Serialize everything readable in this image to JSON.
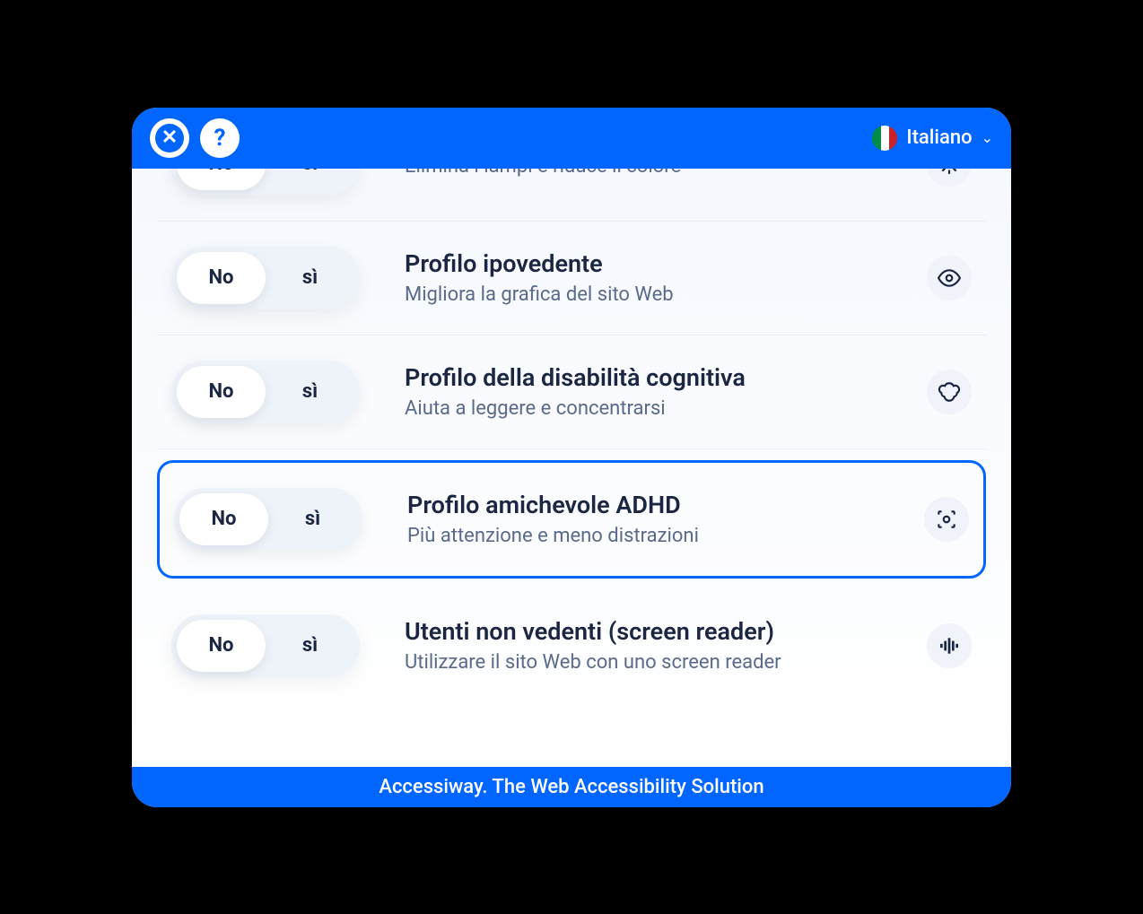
{
  "header": {
    "language_label": "Italiano",
    "flag_colors": [
      "#008c45",
      "#ffffff",
      "#cd212a"
    ]
  },
  "toggle": {
    "no": "No",
    "yes": "sì"
  },
  "profiles": [
    {
      "title": "",
      "desc": "Elimina i lampi e riduce il colore",
      "icon": "sparkle"
    },
    {
      "title": "Profilo ipovedente",
      "desc": "Migliora la grafica del sito Web",
      "icon": "eye"
    },
    {
      "title": "Profilo della disabilità cognitiva",
      "desc": "Aiuta a leggere e concentrarsi",
      "icon": "cloud"
    },
    {
      "title": "Profilo amichevole ADHD",
      "desc": "Più attenzione e meno distrazioni",
      "icon": "focus",
      "highlighted": true
    },
    {
      "title": "Utenti non vedenti (screen reader)",
      "desc": "Utilizzare il sito Web con uno screen reader",
      "icon": "audio"
    }
  ],
  "footer": "Accessiway. The Web Accessibility Solution"
}
